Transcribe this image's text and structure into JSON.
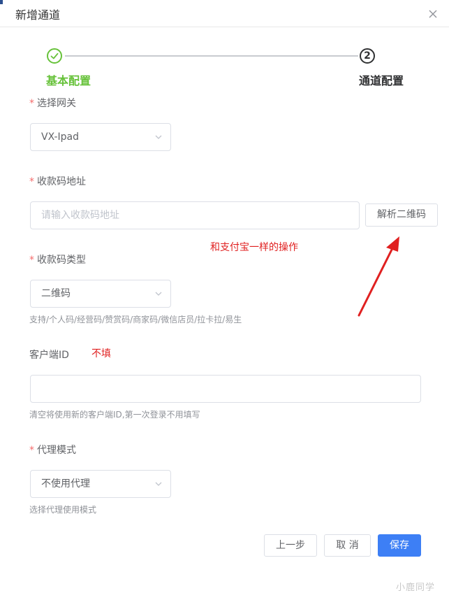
{
  "dialog": {
    "title": "新增通道"
  },
  "steps": [
    {
      "label": "基本配置",
      "status": "done"
    },
    {
      "label": "通道配置",
      "number": "2",
      "status": "current"
    }
  ],
  "form": {
    "gateway": {
      "label": "选择网关",
      "value": "VX-Ipad"
    },
    "qr_address": {
      "label": "收款码地址",
      "placeholder": "请输入收款码地址",
      "value": ""
    },
    "parse_button": "解析二维码",
    "qr_type": {
      "label": "收款码类型",
      "value": "二维码",
      "hint": "支持/个人码/经营码/赞赏码/商家码/微信店员/拉卡拉/易生"
    },
    "client_id": {
      "label": "客户端ID",
      "value": "",
      "hint": "清空将使用新的客户端ID,第一次登录不用填写"
    },
    "proxy_mode": {
      "label": "代理模式",
      "value": "不使用代理",
      "hint": "选择代理使用模式"
    }
  },
  "buttons": {
    "prev": "上一步",
    "cancel": "取 消",
    "save": "保存"
  },
  "annotations": {
    "alipay_note": "和支付宝一样的操作",
    "not_fill": "不填"
  },
  "watermark": "小鹿同学",
  "colors": {
    "primary": "#3d7ff5",
    "success": "#67c23a",
    "required": "#f56c6c",
    "annotation": "#e02020"
  }
}
